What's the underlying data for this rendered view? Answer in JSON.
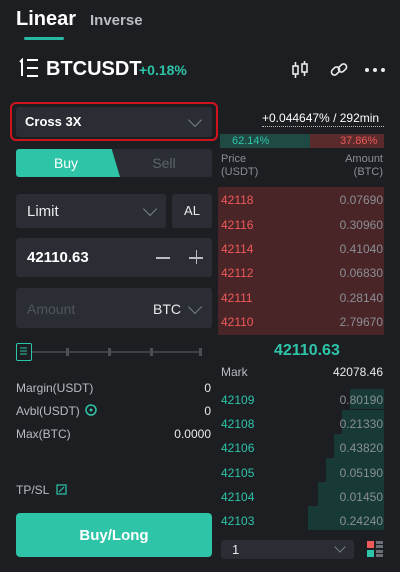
{
  "tabs": {
    "linear": "Linear",
    "inverse": "Inverse"
  },
  "symbol": {
    "name": "BTCUSDT",
    "change": "+0.18%"
  },
  "icons": [
    "candlestick-icon",
    "link-icon",
    "more-icon",
    "menu-icon",
    "grid-icon",
    "chevron-down-icon",
    "info-icon",
    "edit-icon"
  ],
  "colors": {
    "accent": "#2ec4a8",
    "sell": "#ef5a5a",
    "highlight": "#d0141e"
  },
  "order": {
    "margin_mode": "Cross 3X",
    "buy_tab": "Buy",
    "sell_tab": "Sell",
    "order_type": "Limit",
    "al_label": "AL",
    "price": "42110.63",
    "amount_placeholder": "Amount",
    "amount_unit": "BTC",
    "leverage_slider_percent": 0,
    "margin_label": "Margin(USDT)",
    "margin_value": "0",
    "avbl_label": "Avbl(USDT)",
    "avbl_value": "0",
    "max_label": "Max(BTC)",
    "max_value": "0.0000",
    "tpsl_label": "TP/SL",
    "submit_label": "Buy/Long"
  },
  "orderbook": {
    "funding": "+0.044647% / 292min",
    "buy_ratio": "62.14%",
    "sell_ratio": "37.86%",
    "price_head_1": "Price",
    "price_head_2": "(USDT)",
    "amount_head_1": "Amount",
    "amount_head_2": "(BTC)",
    "asks": [
      {
        "price": "42118",
        "amount": "0.07690"
      },
      {
        "price": "42116",
        "amount": "0.30960"
      },
      {
        "price": "42114",
        "amount": "0.41040"
      },
      {
        "price": "42112",
        "amount": "0.06830"
      },
      {
        "price": "42111",
        "amount": "0.28140"
      },
      {
        "price": "42110",
        "amount": "2.79670"
      }
    ],
    "last_price": "42110.63",
    "mark_label": "Mark",
    "mark_price": "42078.46",
    "bids": [
      {
        "price": "42109",
        "amount": "0.80190"
      },
      {
        "price": "42108",
        "amount": "0.21330"
      },
      {
        "price": "42106",
        "amount": "0.43820"
      },
      {
        "price": "42105",
        "amount": "0.05190"
      },
      {
        "price": "42104",
        "amount": "0.01450"
      },
      {
        "price": "42103",
        "amount": "0.24240"
      }
    ],
    "depth": "1"
  }
}
